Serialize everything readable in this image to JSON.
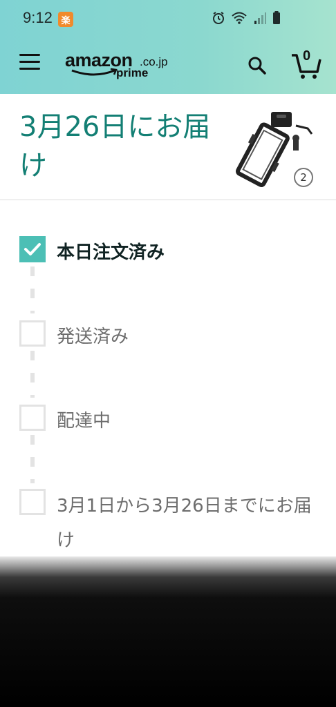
{
  "status_bar": {
    "time": "9:12",
    "app_badge": "楽"
  },
  "header": {
    "logo_text": "amazon",
    "logo_tld": ".co.jp",
    "logo_sub": "prime",
    "cart_count": "0",
    "colors": {
      "gradient_start": "#7fd3d3",
      "gradient_end": "#a6e3cf"
    }
  },
  "delivery": {
    "title": "3月26日にお届け",
    "item_count": "2",
    "title_color": "#137f74"
  },
  "tracker": {
    "accent_color": "#4cbfb5",
    "steps": [
      {
        "label": "本日注文済み",
        "checked": true
      },
      {
        "label": "発送済み",
        "checked": false
      },
      {
        "label": "配達中",
        "checked": false
      },
      {
        "label": "3月1日から3月26日までにお届け",
        "checked": false
      }
    ]
  }
}
